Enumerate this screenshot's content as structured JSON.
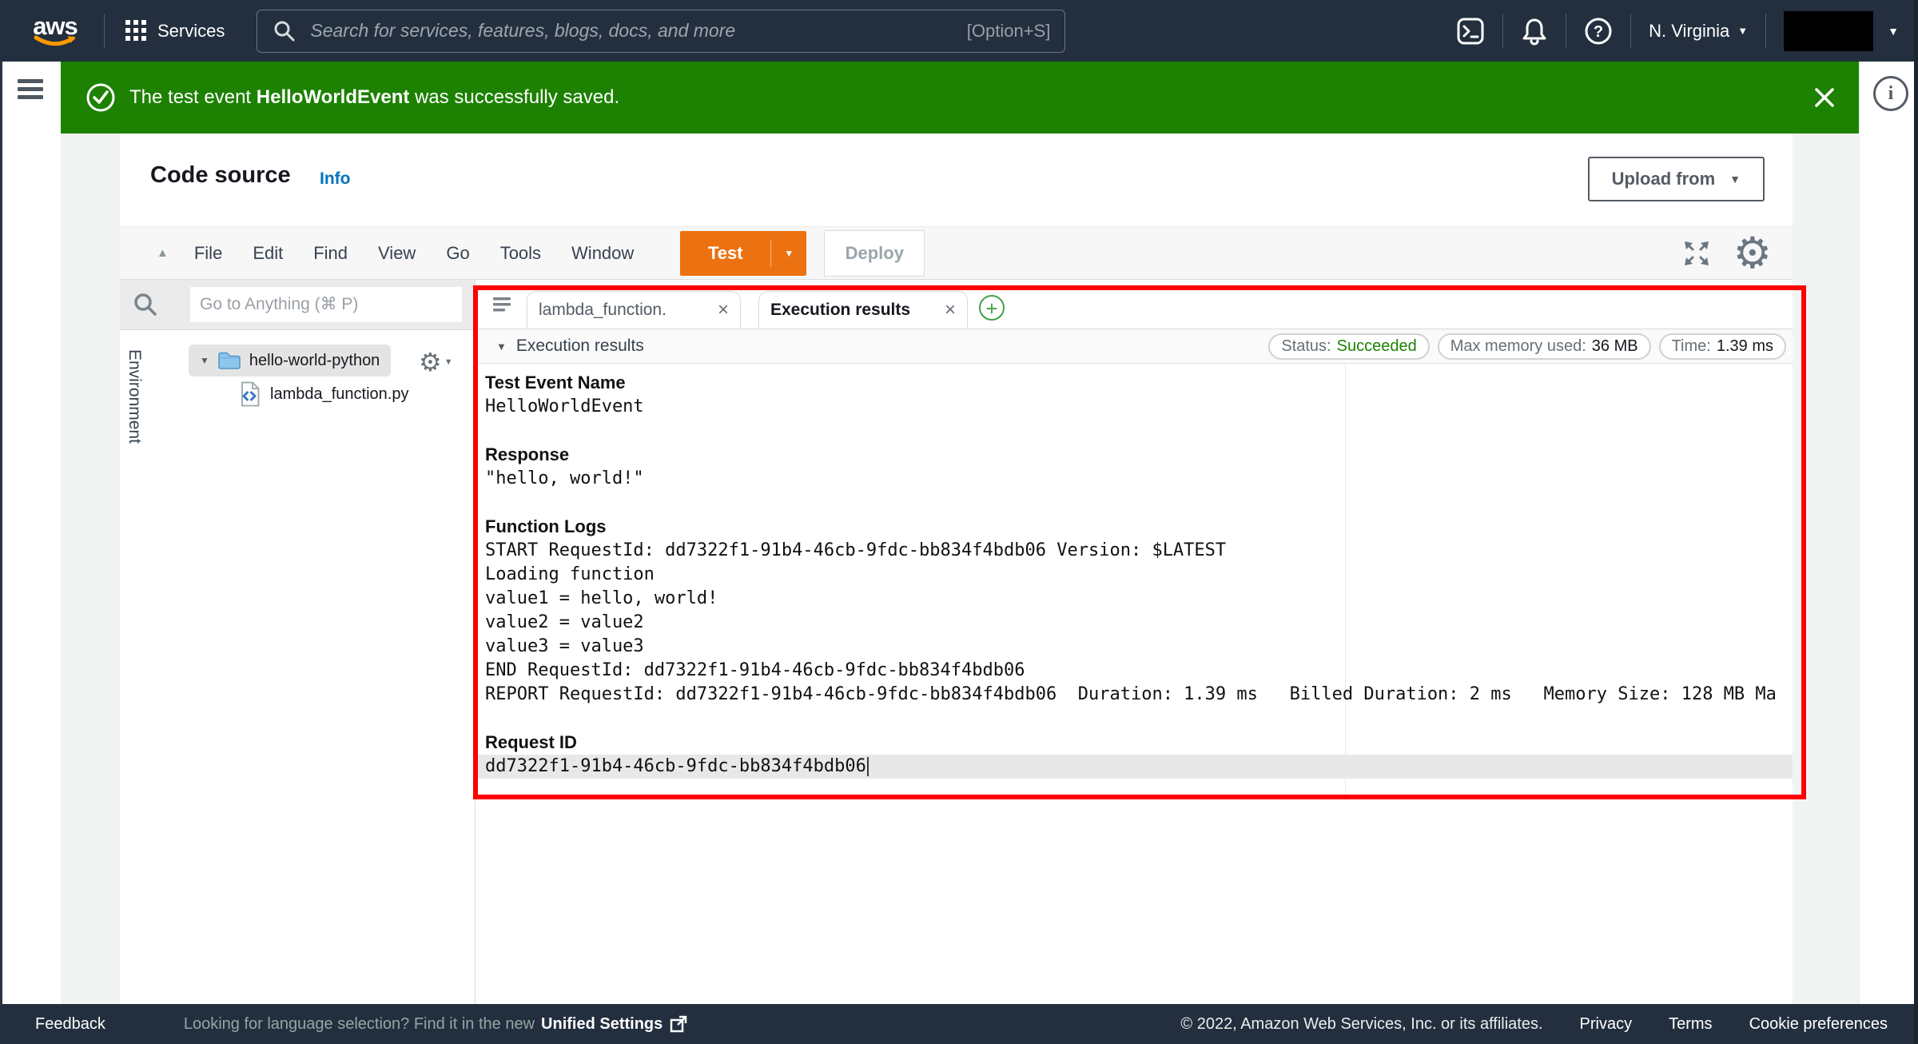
{
  "navbar": {
    "logo": "aws",
    "services_label": "Services",
    "search_placeholder": "Search for services, features, blogs, docs, and more",
    "search_shortcut": "[Option+S]",
    "region": "N. Virginia",
    "region_caret": "▼",
    "account_caret": "▼"
  },
  "banner": {
    "message_prefix": "The test event ",
    "event_name": "HelloWorldEvent",
    "message_suffix": " was successfully saved."
  },
  "code_source": {
    "title": "Code source",
    "info_label": "Info",
    "upload_button": "Upload from",
    "upload_caret": "▼"
  },
  "menubar": {
    "collapse_caret": "▲",
    "items": [
      "File",
      "Edit",
      "Find",
      "View",
      "Go",
      "Tools",
      "Window"
    ],
    "test_button": "Test",
    "test_caret": "▼",
    "deploy_button": "Deploy"
  },
  "explorer": {
    "search_placeholder": "Go to Anything (⌘ P)",
    "environment_label": "Environment",
    "folder_caret": "▼",
    "folder_name": "hello-world-python",
    "gear_caret": "▼",
    "file_name": "lambda_function.py"
  },
  "editor": {
    "tabs": [
      {
        "label": "lambda_function.",
        "close": "×",
        "active": false
      },
      {
        "label": "Execution results",
        "close": "×",
        "active": true
      }
    ],
    "new_tab_button": "+",
    "results": {
      "caret": "▼",
      "title": "Execution results",
      "badges": [
        {
          "label": "Status:",
          "value": "Succeeded",
          "value_color": "#1d8102"
        },
        {
          "label": "Max memory used:",
          "value": "36 MB",
          "value_color": "#16191f"
        },
        {
          "label": "Time:",
          "value": "1.39 ms",
          "value_color": "#16191f"
        }
      ],
      "lines": [
        {
          "type": "header",
          "text": "Test Event Name"
        },
        {
          "type": "mono",
          "text": "HelloWorldEvent"
        },
        {
          "type": "blank",
          "text": ""
        },
        {
          "type": "header",
          "text": "Response"
        },
        {
          "type": "mono",
          "text": "\"hello, world!\""
        },
        {
          "type": "blank",
          "text": ""
        },
        {
          "type": "header",
          "text": "Function Logs"
        },
        {
          "type": "mono",
          "text": "START RequestId: dd7322f1-91b4-46cb-9fdc-bb834f4bdb06 Version: $LATEST"
        },
        {
          "type": "mono",
          "text": "Loading function"
        },
        {
          "type": "mono",
          "text": "value1 = hello, world!"
        },
        {
          "type": "mono",
          "text": "value2 = value2"
        },
        {
          "type": "mono",
          "text": "value3 = value3"
        },
        {
          "type": "mono",
          "text": "END RequestId: dd7322f1-91b4-46cb-9fdc-bb834f4bdb06"
        },
        {
          "type": "mono",
          "text": "REPORT RequestId: dd7322f1-91b4-46cb-9fdc-bb834f4bdb06  Duration: 1.39 ms   Billed Duration: 2 ms   Memory Size: 128 MB Ma"
        },
        {
          "type": "blank",
          "text": ""
        },
        {
          "type": "header",
          "text": "Request ID"
        },
        {
          "type": "mono-highlight",
          "text": "dd7322f1-91b4-46cb-9fdc-bb834f4bdb06"
        }
      ]
    }
  },
  "footer": {
    "feedback": "Feedback",
    "language_prefix": "Looking for language selection? Find it in the new ",
    "unified_settings": "Unified Settings",
    "copyright": "© 2022, Amazon Web Services, Inc. or its affiliates.",
    "links": [
      "Privacy",
      "Terms",
      "Cookie preferences"
    ]
  },
  "colors": {
    "navbar_bg": "#232f3e",
    "banner_green": "#1d8102",
    "test_orange": "#ec7211",
    "link_blue": "#0073bb",
    "highlight_red": "#ff0000"
  }
}
